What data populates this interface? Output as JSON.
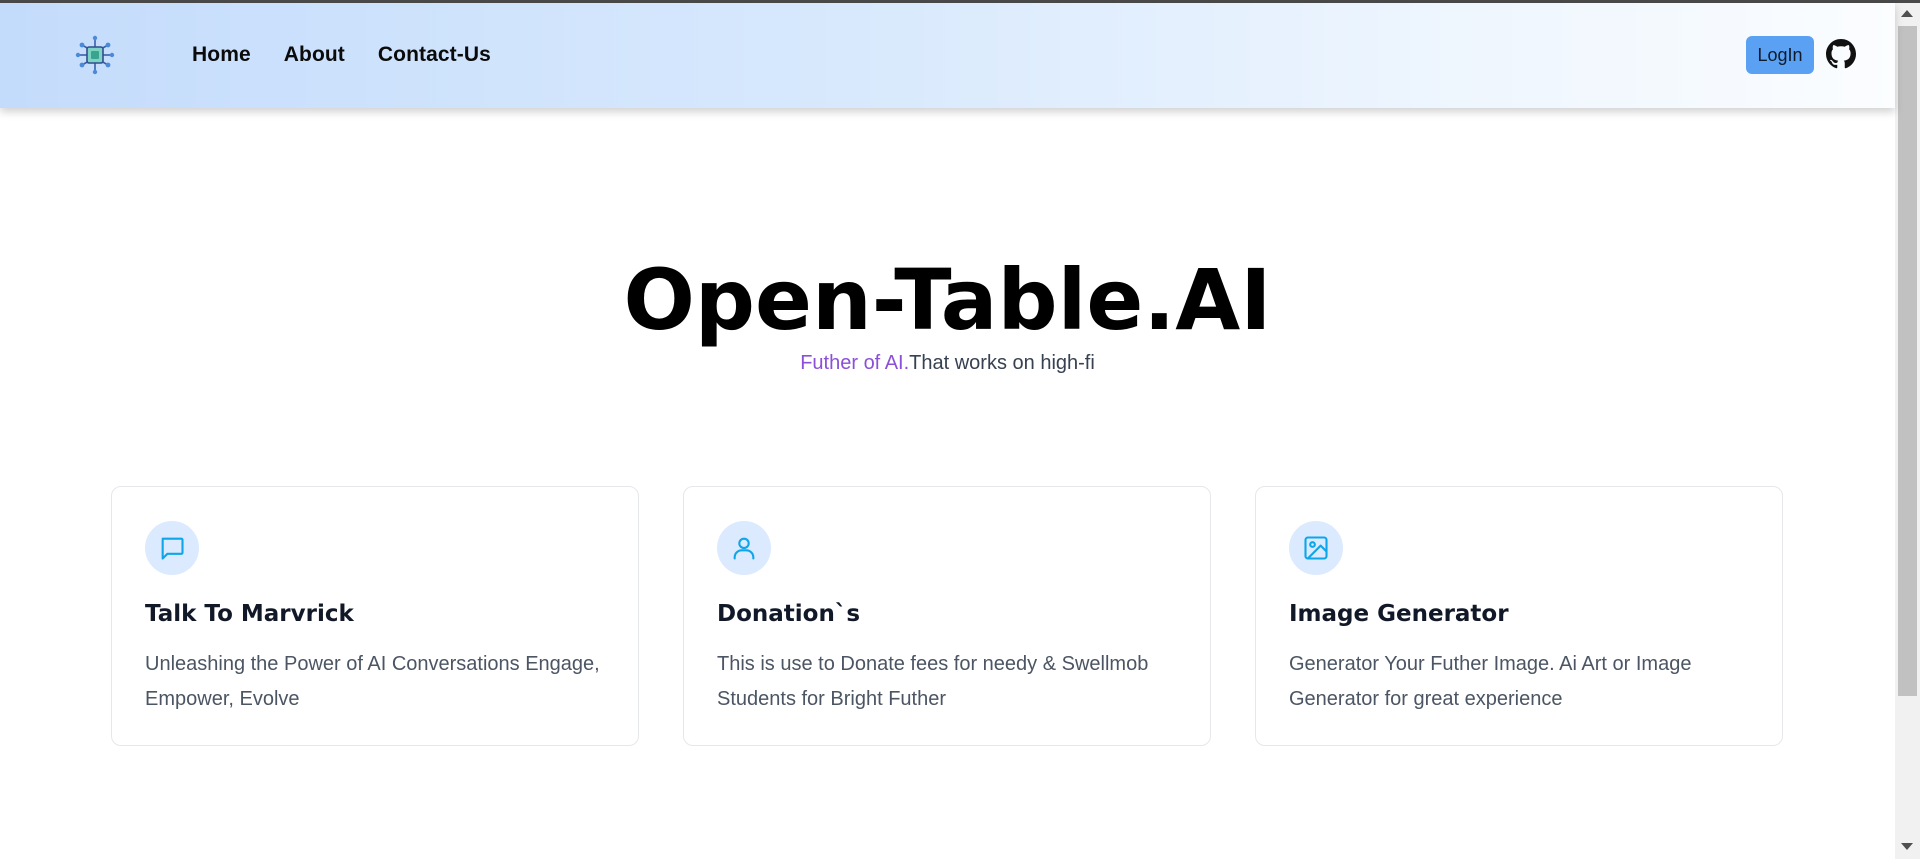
{
  "nav": {
    "logo_icon": "chip-icon",
    "links": [
      "Home",
      "About",
      "Contact-Us"
    ],
    "login_label": "LogIn",
    "github_icon": "github-icon"
  },
  "hero": {
    "title": "Open-Table.AI",
    "subtitle_accent": "Futher of AI.",
    "subtitle_rest": "That works on high-fi"
  },
  "cards": [
    {
      "icon": "chat-bubble-icon",
      "title": "Talk To Marvrick",
      "description": "Unleashing the Power of AI Conversations Engage, Empower, Evolve"
    },
    {
      "icon": "user-icon",
      "title": "Donation`s",
      "description": "This is use to Donate fees for needy & Swellmob Students for Bright Futher"
    },
    {
      "icon": "image-icon",
      "title": "Image Generator",
      "description": "Generator Your Futher Image. Ai Art or Image Generator for great experience"
    }
  ],
  "colors": {
    "accent": "#5aa0f3",
    "subtitle_accent": "#8b4fd8",
    "icon_bg": "#dbeafe",
    "icon_stroke": "#0ea5e9"
  }
}
